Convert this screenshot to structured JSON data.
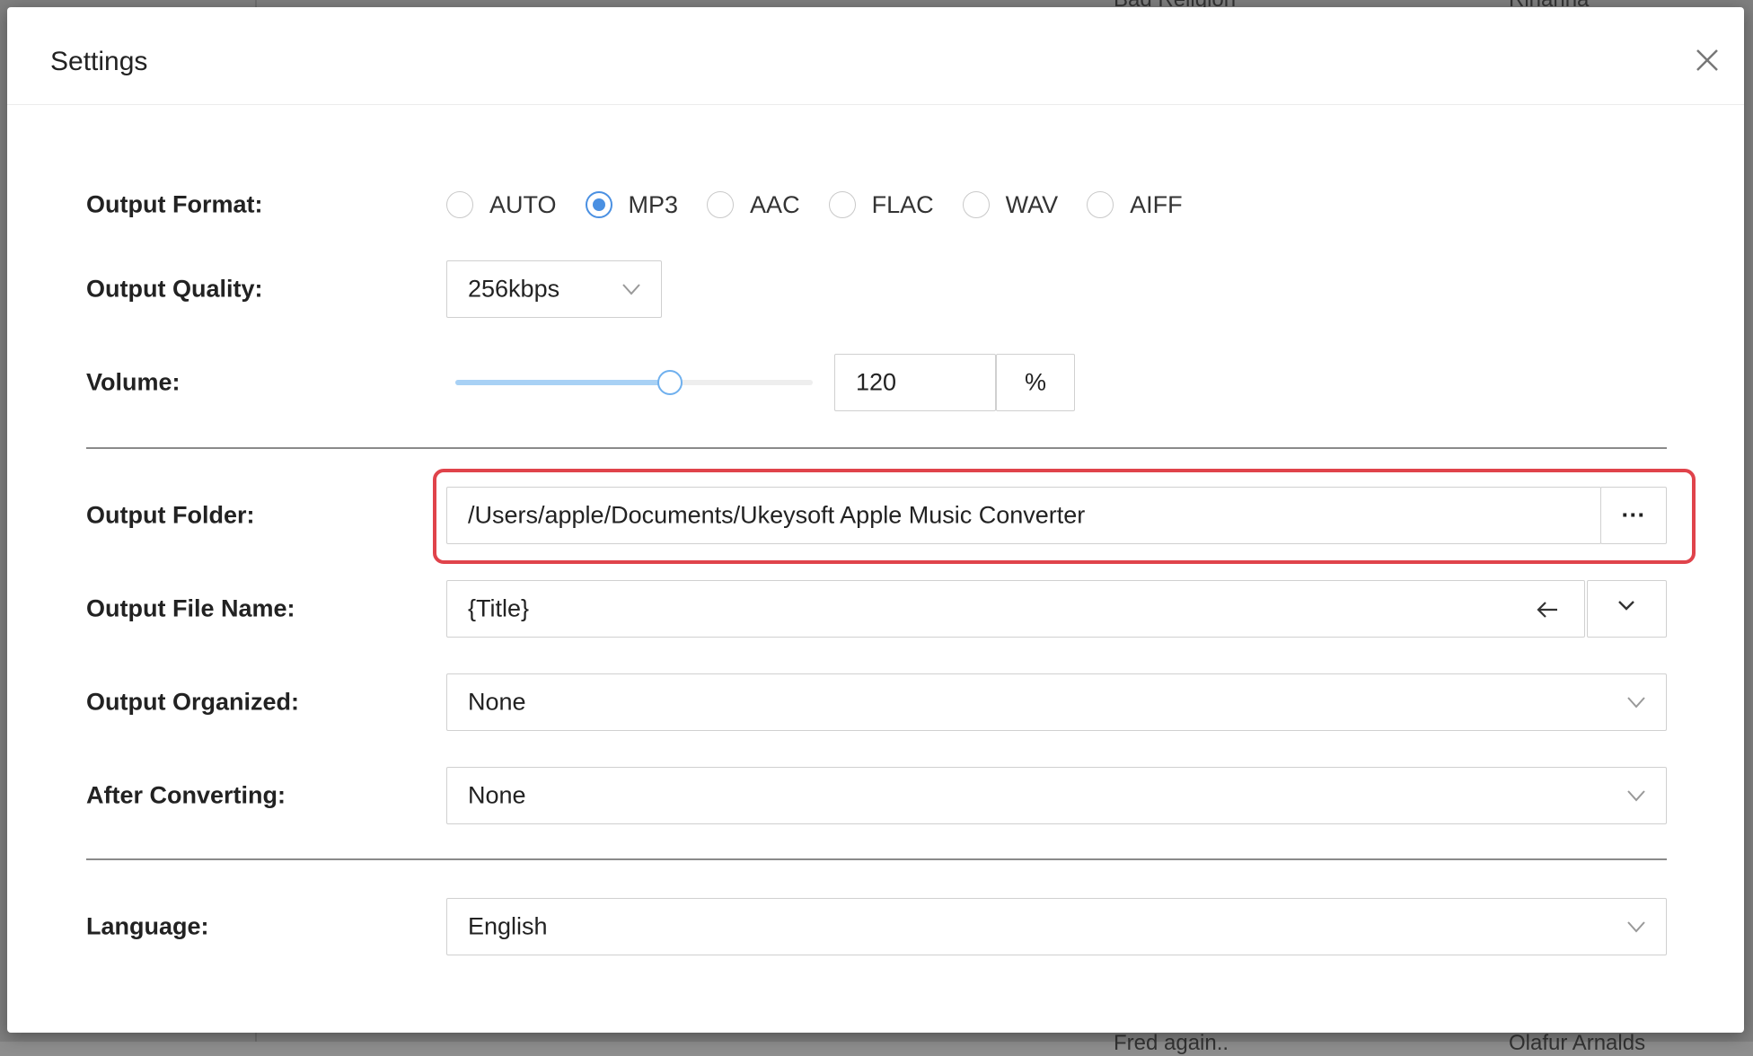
{
  "background": {
    "fragments": [
      "Bad Religion",
      "Rihanna",
      "Fred again..",
      "Olafur Arnalds"
    ]
  },
  "dialog": {
    "title": "Settings",
    "close_icon": "close-icon"
  },
  "settings": {
    "output_format": {
      "label": "Output Format:",
      "options": [
        "AUTO",
        "MP3",
        "AAC",
        "FLAC",
        "WAV",
        "AIFF"
      ],
      "selected": "MP3"
    },
    "output_quality": {
      "label": "Output Quality:",
      "value": "256kbps"
    },
    "volume": {
      "label": "Volume:",
      "value": "120",
      "unit": "%",
      "slider_fraction": 0.6
    },
    "output_folder": {
      "label": "Output Folder:",
      "value": "/Users/apple/Documents/Ukeysoft Apple Music Converter",
      "browse_label": "···"
    },
    "output_file_name": {
      "label": "Output File Name:",
      "value": "{Title}"
    },
    "output_organized": {
      "label": "Output Organized:",
      "value": "None"
    },
    "after_converting": {
      "label": "After Converting:",
      "value": "None"
    },
    "language": {
      "label": "Language:",
      "value": "English"
    }
  },
  "colors": {
    "accent": "#4a90e2",
    "highlight": "#e0434b",
    "slider_fill": "#a8d1f5"
  }
}
